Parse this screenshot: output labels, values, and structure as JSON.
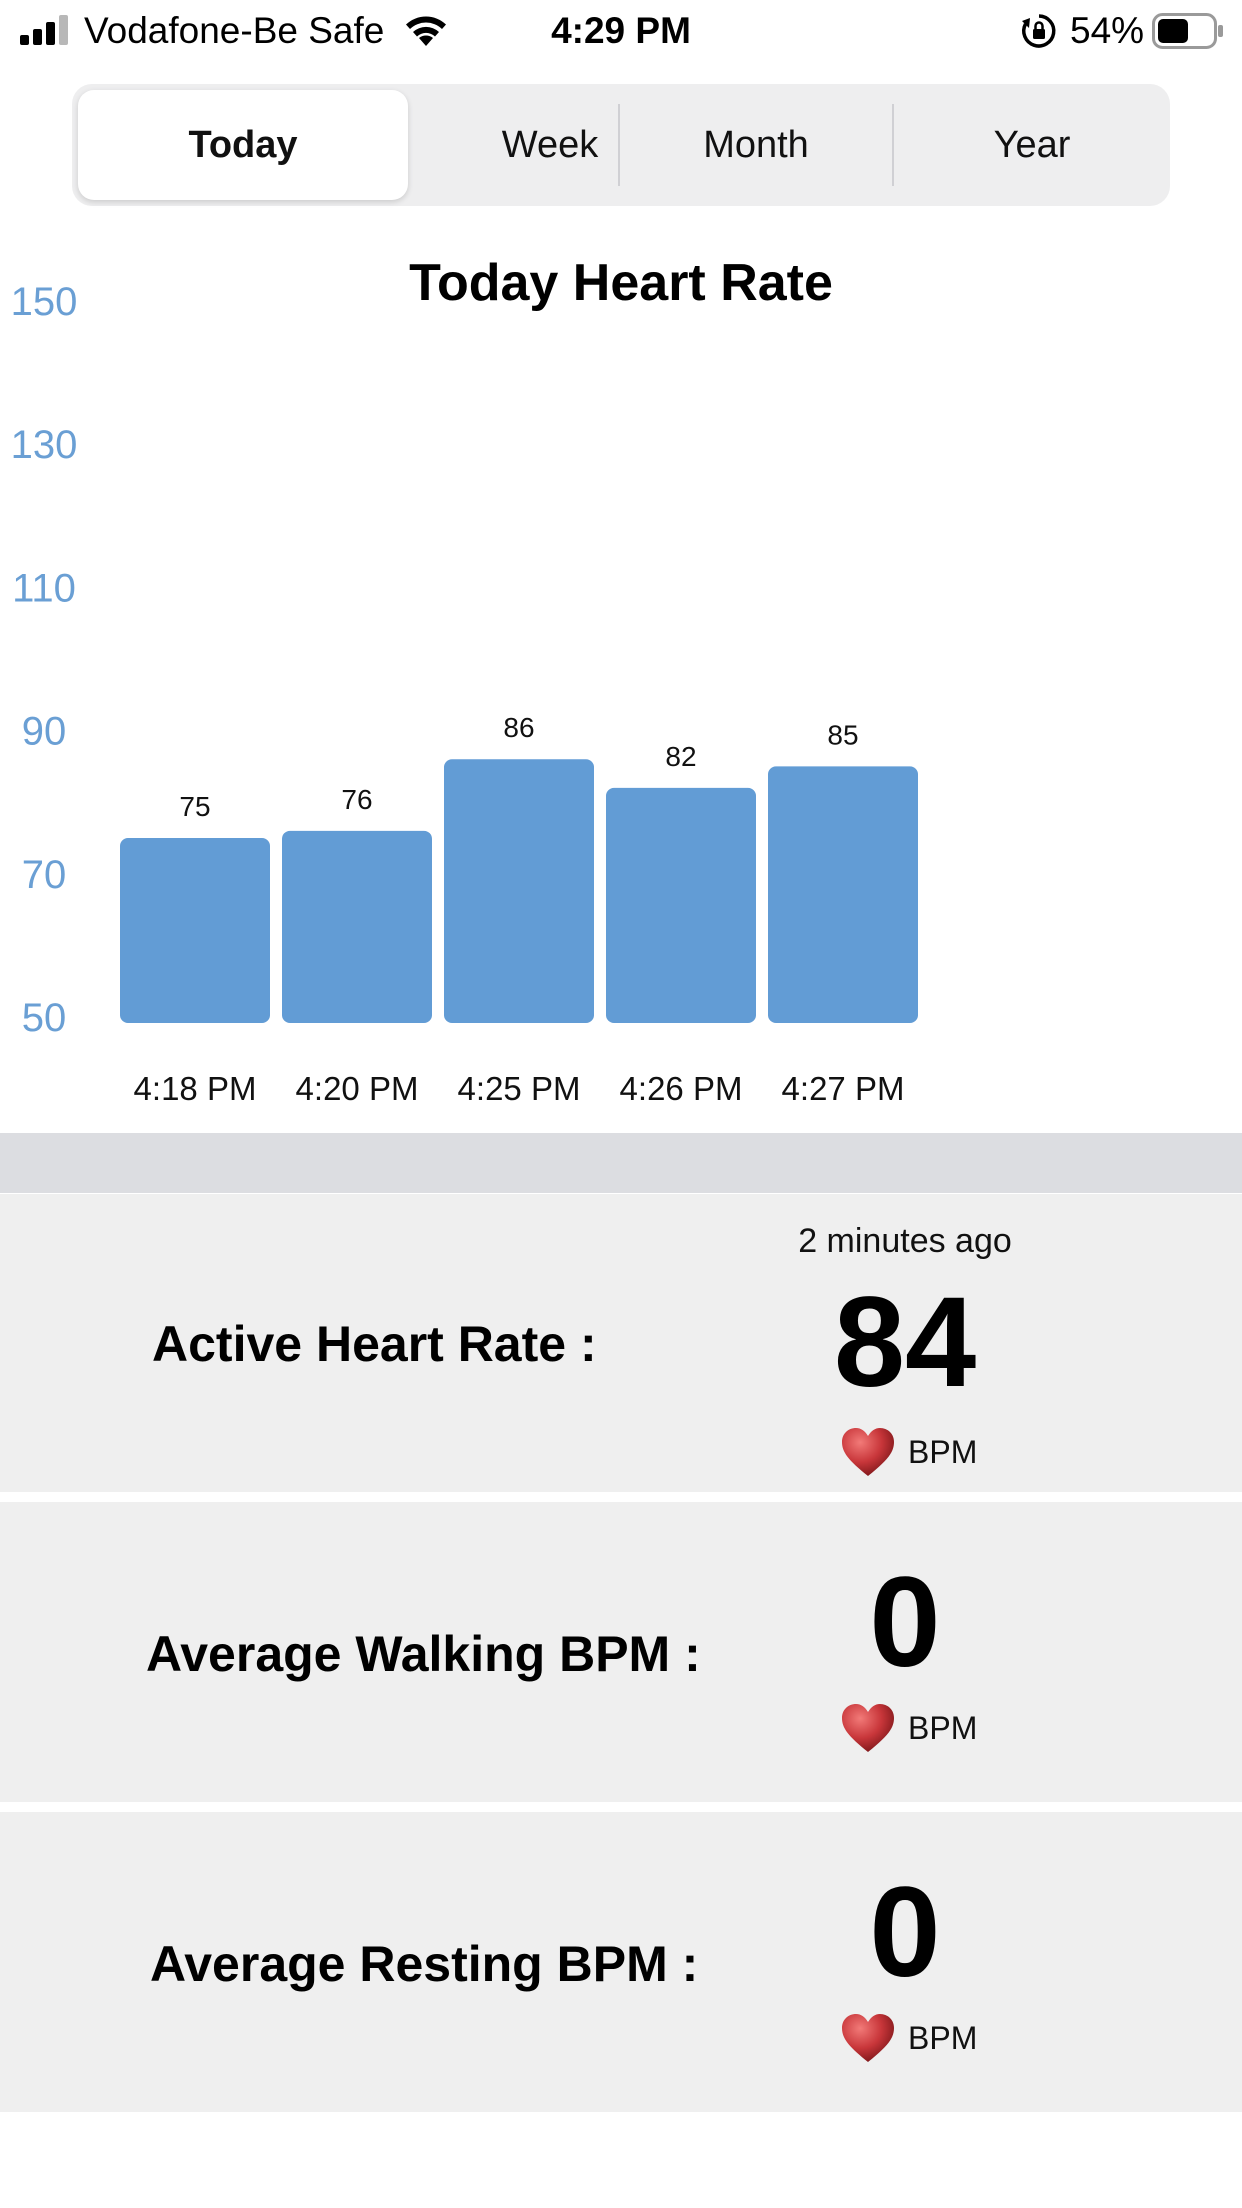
{
  "status_bar": {
    "carrier": "Vodafone-Be Safe",
    "time": "4:29 PM",
    "battery_percent": "54%",
    "icons": [
      "signal-icon",
      "wifi-icon",
      "rotation-lock-icon",
      "battery-icon"
    ]
  },
  "segmented": {
    "selected": "Today",
    "items": [
      "Today",
      "Week",
      "Month",
      "Year"
    ]
  },
  "chart_data": {
    "type": "bar",
    "title": "Today Heart Rate",
    "categories": [
      "4:18 PM",
      "4:20 PM",
      "4:25 PM",
      "4:26 PM",
      "4:27 PM"
    ],
    "values": [
      75,
      76,
      86,
      82,
      85
    ],
    "value_labels": [
      "75",
      "76",
      "86",
      "82",
      "85"
    ],
    "y_ticks": [
      150,
      130,
      110,
      90,
      70,
      50
    ],
    "y_tick_labels": [
      "150",
      "130",
      "110",
      "90",
      "70",
      "50"
    ],
    "ylim": [
      50,
      150
    ],
    "grid": false,
    "bar_color": "#629cd5",
    "axis_label_color": "#6a9fd4"
  },
  "cards": [
    {
      "label": "Active Heart Rate :",
      "timestamp": "2 minutes ago",
      "value": "84",
      "unit": "BPM",
      "icon": "heart-icon"
    },
    {
      "label": "Average Walking BPM :",
      "value": "0",
      "unit": "BPM",
      "icon": "heart-icon"
    },
    {
      "label": "Average Resting BPM :",
      "value": "0",
      "unit": "BPM",
      "icon": "heart-icon"
    }
  ],
  "colors": {
    "card_background": "#efefef",
    "separator": "#dcdde1",
    "heart": "#c8363a"
  }
}
